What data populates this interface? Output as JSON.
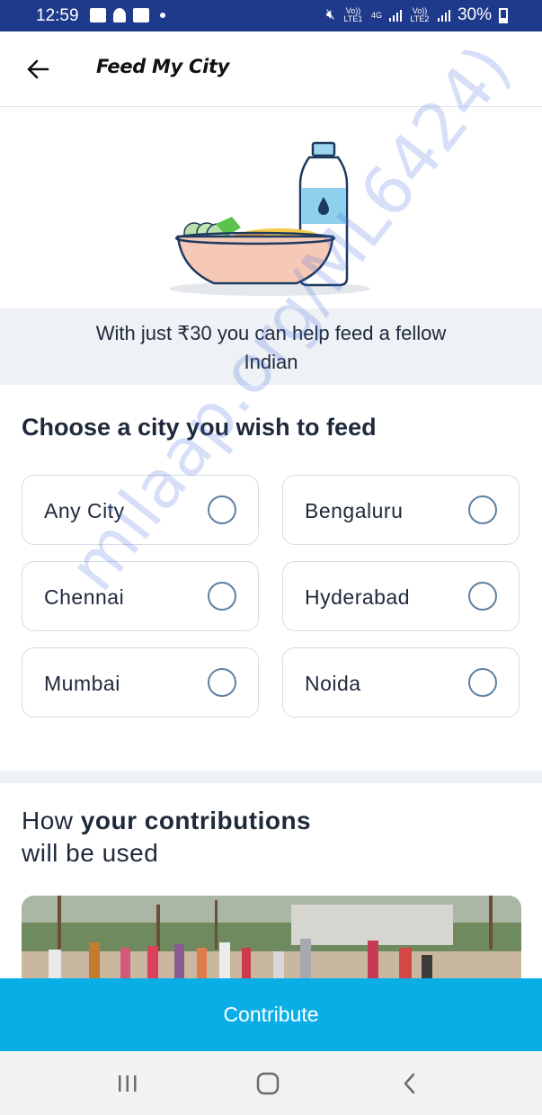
{
  "status_bar": {
    "time": "12:59",
    "network_1": "Vo)) LTE1",
    "network_gen": "4G",
    "network_2": "Vo)) LTE2",
    "battery": "30%"
  },
  "header": {
    "back_icon": "arrow-left-icon",
    "title": "Feed My City"
  },
  "tagline": "With just ₹30 you can help feed a fellow Indian",
  "city_section": {
    "title": "Choose a city you wish to feed",
    "cities": [
      {
        "label": "Any City",
        "selected": false
      },
      {
        "label": "Bengaluru",
        "selected": false
      },
      {
        "label": "Chennai",
        "selected": false
      },
      {
        "label": "Hyderabad",
        "selected": false
      },
      {
        "label": "Mumbai",
        "selected": false
      },
      {
        "label": "Noida",
        "selected": false
      }
    ]
  },
  "how_section": {
    "title_prefix": "How",
    "title_bold": "your contributions",
    "title_suffix": "will be used"
  },
  "contribute_button": "Contribute",
  "watermark": "milaap.org/ML6424)",
  "colors": {
    "status_bar": "#1f3a8a",
    "accent": "#0aaee6",
    "radio_border": "#5f7fa3",
    "tagline_bg": "#eef1f5"
  }
}
